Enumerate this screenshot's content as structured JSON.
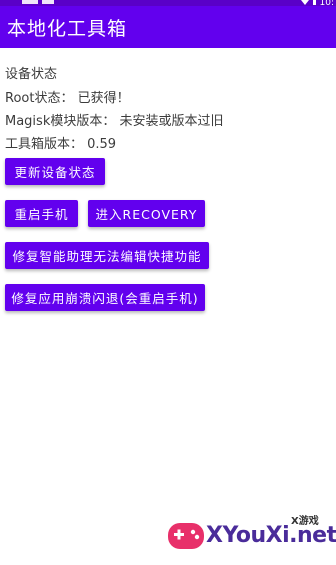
{
  "status_bar": {
    "time": "10:"
  },
  "app": {
    "title": "本地化工具箱"
  },
  "info": {
    "device_status": "设备状态",
    "root_status": "Root状态： 已获得！",
    "magisk_version": "Magisk模块版本： 未安装或版本过旧",
    "toolbox_version": "工具箱版本： 0.59"
  },
  "buttons": {
    "update_status": "更新设备状态",
    "reboot": "重启手机",
    "enter_recovery": "进入RECOVERY",
    "fix_assistant": "修复智能助理无法编辑快捷功能",
    "fix_crash": "修复应用崩溃闪退(会重启手机)"
  },
  "watermark": {
    "text": "XYouXi.net",
    "small": "X游戏"
  },
  "colors": {
    "primary": "#6200ee",
    "primary_dark": "#5a00c8"
  }
}
